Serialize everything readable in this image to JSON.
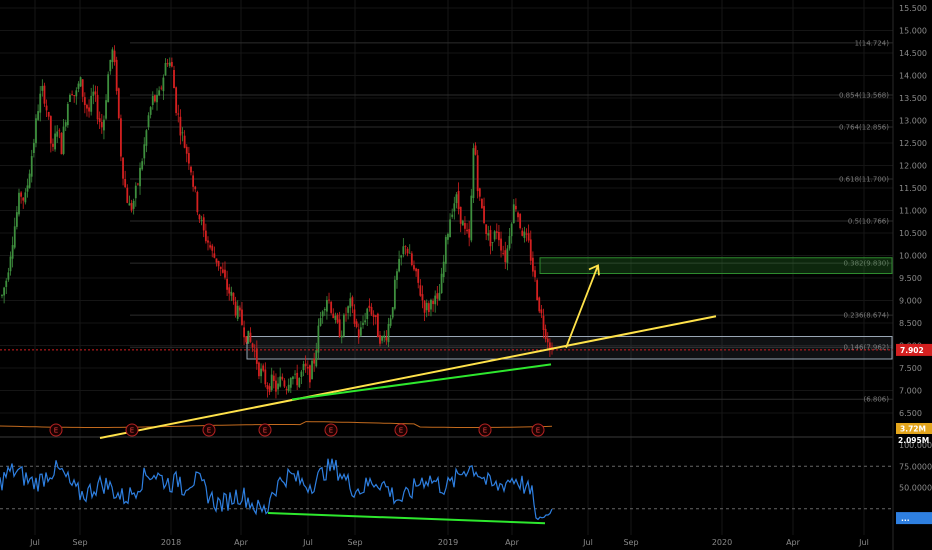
{
  "chart_data": [
    {
      "type": "candlestick",
      "colors": {
        "up": "#3e8f3e",
        "down": "#d42020",
        "background": "#000000"
      },
      "y_axis": {
        "ylim": [
          6.3,
          15.5
        ],
        "tick_labels": [
          "15.500",
          "15.000",
          "14.500",
          "14.000",
          "13.500",
          "13.000",
          "12.500",
          "12.000",
          "11.500",
          "11.000",
          "10.500",
          "10.000",
          "9.500",
          "9.000",
          "8.500",
          "8.000",
          "7.500",
          "7.000",
          "6.500"
        ]
      },
      "x_axis": {
        "tick_labels": [
          "Jul",
          "Sep",
          "2018",
          "Apr",
          "Jul",
          "Sep",
          "2019",
          "Apr",
          "Jul",
          "Sep",
          "2020",
          "Apr",
          "Jul"
        ]
      },
      "current_price": {
        "label": "7.902",
        "value": 7.902,
        "color": "#d42020"
      },
      "fib_levels": [
        {
          "label": "1(14.724)",
          "value": 14.724
        },
        {
          "label": "0.854(13.568)",
          "value": 13.568
        },
        {
          "label": "0.764(12.856)",
          "value": 12.856
        },
        {
          "label": "0.618(11.700)",
          "value": 11.7
        },
        {
          "label": "0.5(10.766)",
          "value": 10.766
        },
        {
          "label": "0.382(9.830)",
          "value": 9.83
        },
        {
          "label": "0.236(8.674)",
          "value": 8.674
        },
        {
          "label": "0.146(7.962)",
          "value": 7.962
        },
        {
          "label": "(6.806)",
          "value": 6.806
        }
      ],
      "price_series": [
        9.1,
        9.5,
        10.2,
        10.8,
        11.4,
        11.2,
        11.9,
        12.6,
        13.4,
        13.7,
        13.1,
        12.2,
        12.9,
        12.4,
        13.2,
        13.8,
        13.5,
        13.9,
        13.4,
        13.2,
        13.6,
        13.1,
        12.8,
        13.9,
        14.6,
        13.8,
        12.2,
        11.4,
        11.0,
        11.3,
        11.8,
        12.4,
        13.1,
        13.5,
        13.4,
        13.9,
        14.4,
        14.2,
        13.3,
        12.8,
        12.4,
        12.1,
        11.4,
        10.9,
        10.5,
        10.3,
        10.0,
        9.9,
        9.6,
        9.3,
        9.1,
        8.8,
        8.6,
        8.3,
        8.1,
        7.9,
        7.5,
        7.3,
        7.1,
        7.2,
        7.0,
        7.3,
        7.1,
        7.4,
        7.2,
        7.3,
        7.5,
        7.3,
        7.6,
        8.3,
        8.9,
        9.1,
        8.8,
        8.4,
        8.3,
        8.7,
        8.9,
        8.5,
        8.2,
        8.6,
        8.9,
        8.7,
        8.3,
        8.1,
        8.3,
        8.8,
        9.5,
        9.9,
        10.3,
        9.9,
        9.6,
        9.3,
        8.9,
        8.8,
        9.1,
        8.9,
        9.5,
        10.4,
        11.0,
        11.3,
        10.9,
        10.5,
        10.3,
        12.7,
        11.3,
        10.9,
        10.4,
        10.3,
        10.6,
        10.2,
        9.9,
        10.8,
        11.2,
        10.7,
        10.4,
        10.2,
        9.6,
        9.0,
        8.5,
        8.2,
        7.9
      ],
      "events": {
        "label": "E",
        "count": 8
      },
      "volume_labels": {
        "current": "3.72M",
        "scale": "2.095M"
      }
    },
    {
      "type": "line",
      "name": "oscillator",
      "y_axis": {
        "tick_labels": [
          "75.0000",
          "50.0000"
        ],
        "current_label": "..."
      },
      "upper_band": 75,
      "lower_band": 25,
      "colors": {
        "line": "#2e7fe0",
        "divergence": "#2ee82e"
      }
    }
  ],
  "drawings": {
    "support_rect_color": "#9aa7b5",
    "target_rect_color": "#2e8b2e",
    "trendline_color": "#ffe24a",
    "arrow_color": "#ffe24a",
    "divergence_color": "#2ee82e"
  }
}
